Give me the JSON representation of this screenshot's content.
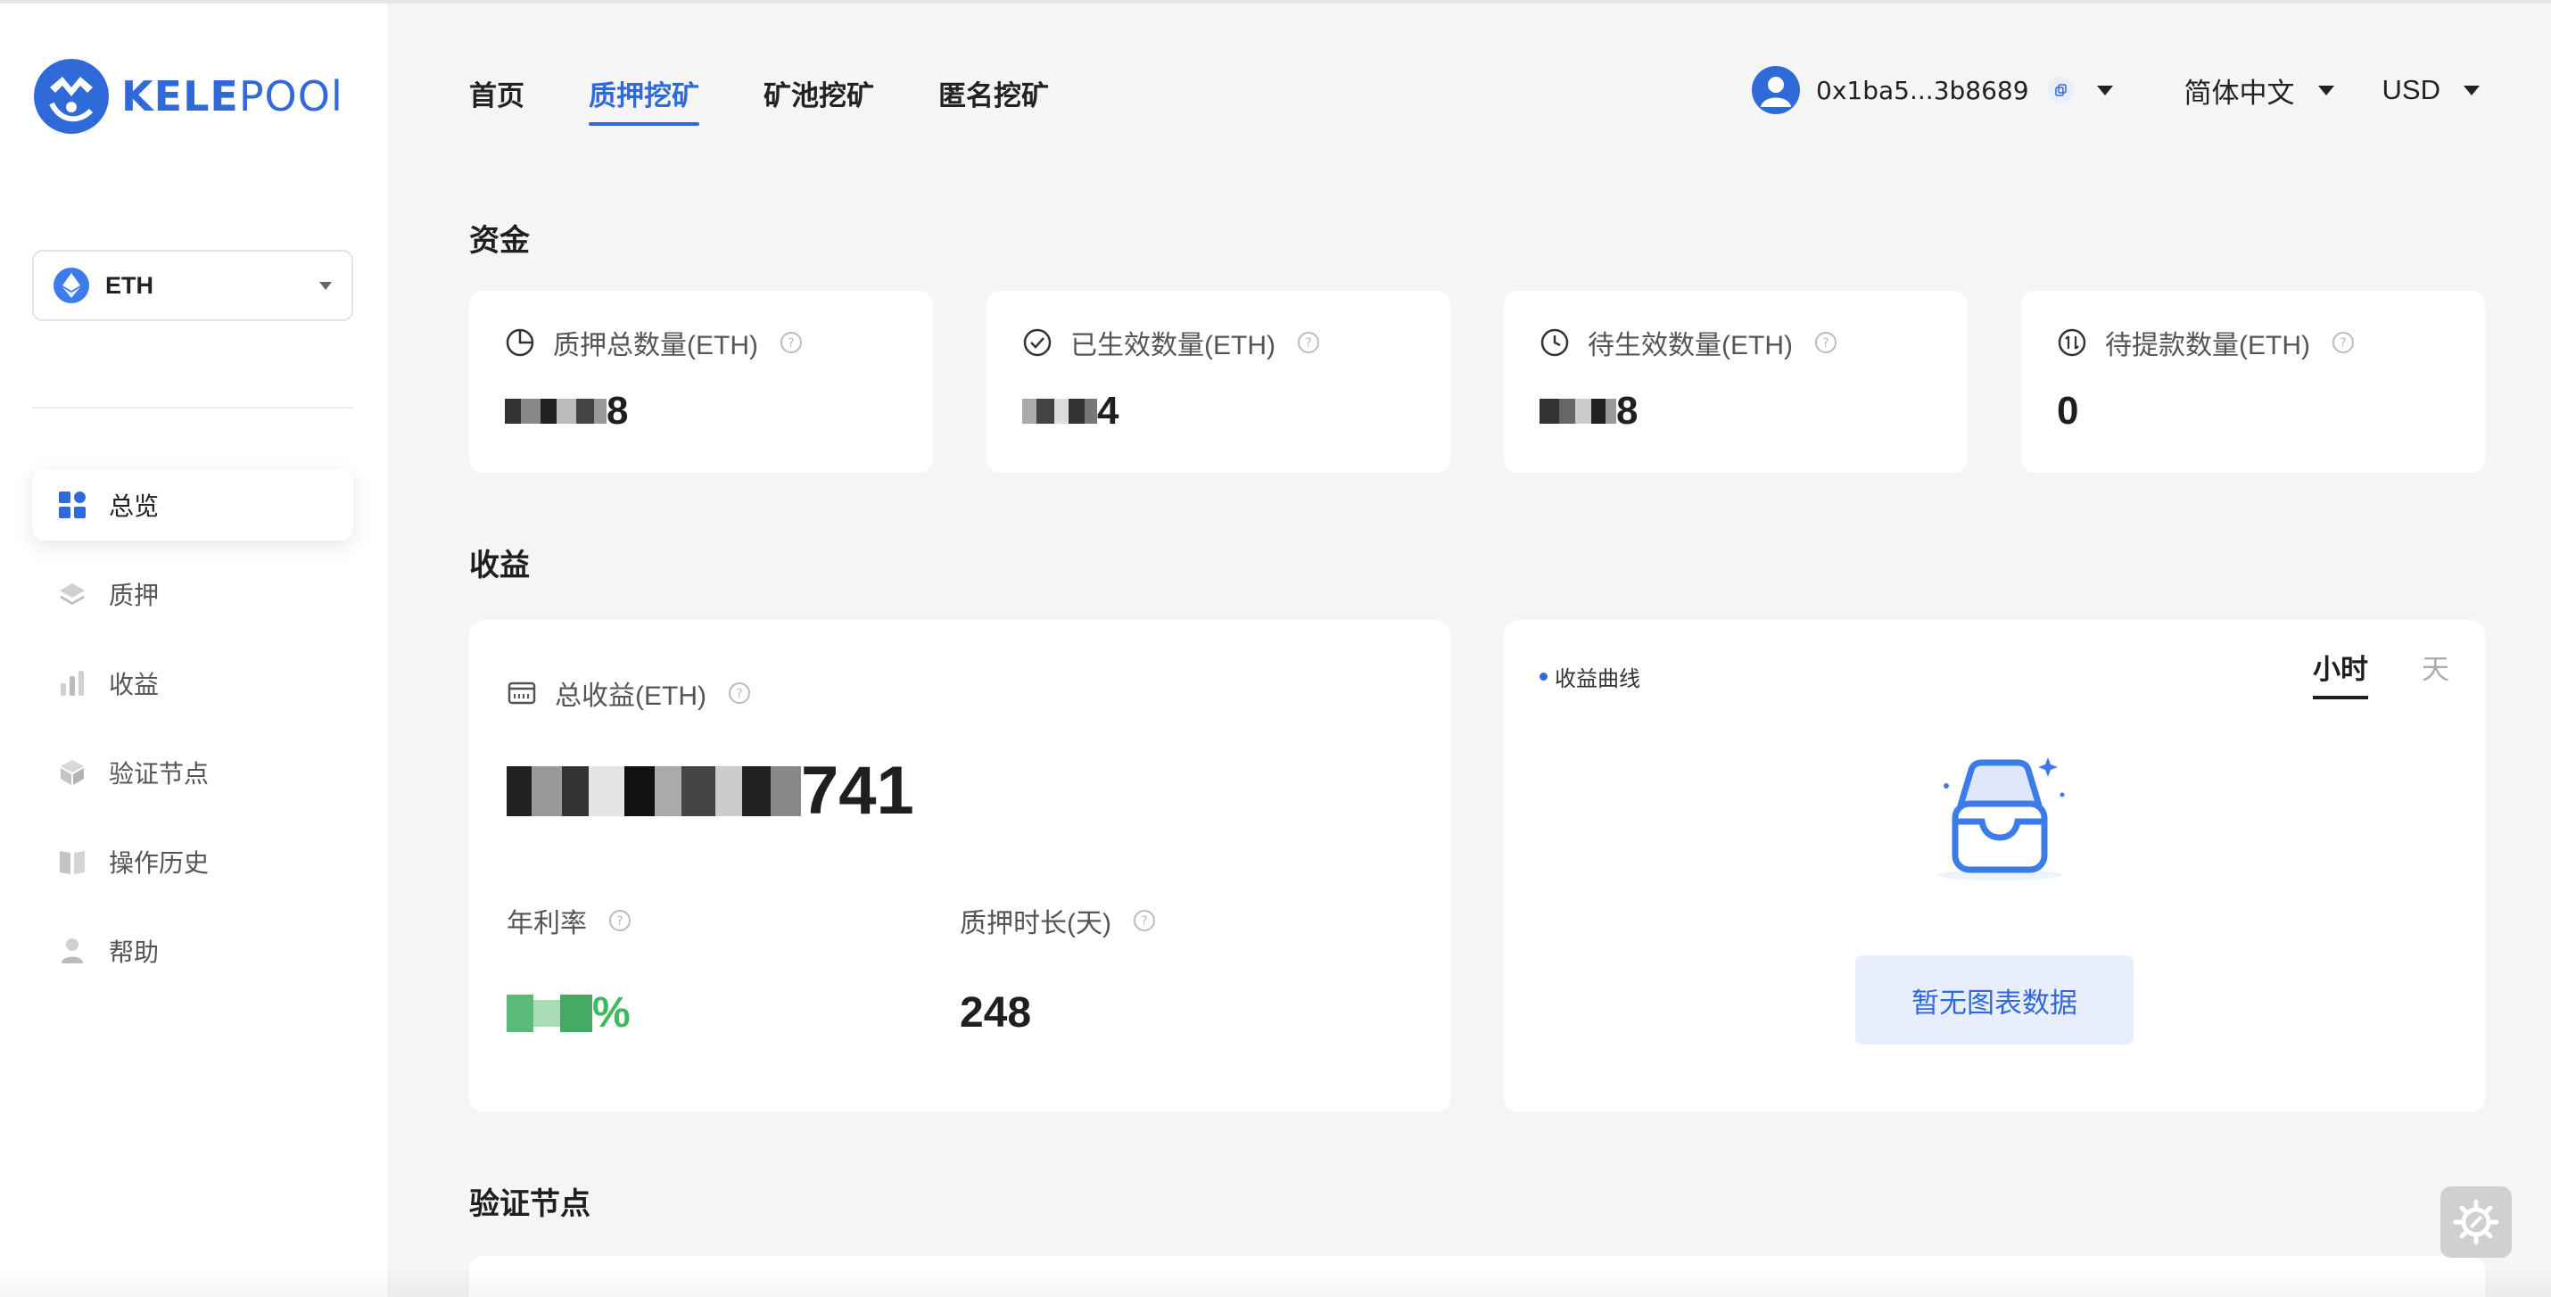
{
  "brand": {
    "name_bold": "KELE",
    "name_light": "POOl"
  },
  "asset": {
    "label": "ETH"
  },
  "sidebar": {
    "items": [
      {
        "label": "总览",
        "icon": "dashboard-icon",
        "active": true
      },
      {
        "label": "质押",
        "icon": "layers-icon",
        "active": false
      },
      {
        "label": "收益",
        "icon": "bar-chart-icon",
        "active": false
      },
      {
        "label": "验证节点",
        "icon": "cube-icon",
        "active": false
      },
      {
        "label": "操作历史",
        "icon": "book-icon",
        "active": false
      },
      {
        "label": "帮助",
        "icon": "user-help-icon",
        "active": false
      }
    ]
  },
  "topnav": {
    "items": [
      {
        "label": "首页",
        "active": false
      },
      {
        "label": "质押挖矿",
        "active": true
      },
      {
        "label": "矿池挖矿",
        "active": false
      },
      {
        "label": "匿名挖矿",
        "active": false
      }
    ]
  },
  "header": {
    "wallet": "0x1ba5...3b8689",
    "language": "简体中文",
    "currency": "USD"
  },
  "sections": {
    "funds": "资金",
    "earnings": "收益",
    "validators": "验证节点"
  },
  "stats": [
    {
      "label": "质押总数量(ETH)",
      "icon": "pie-icon",
      "value_visible": "8"
    },
    {
      "label": "已生效数量(ETH)",
      "icon": "check-circle-icon",
      "value_visible": "4"
    },
    {
      "label": "待生效数量(ETH)",
      "icon": "clock-icon",
      "value_visible": "8"
    },
    {
      "label": "待提款数量(ETH)",
      "icon": "withdraw-icon",
      "value_visible": "0"
    }
  ],
  "earnings": {
    "total_label": "总收益(ETH)",
    "total_value_visible": "741",
    "apr_label": "年利率",
    "apr_suffix": "%",
    "duration_label": "质押时长(天)",
    "duration_value": "248"
  },
  "chart": {
    "legend": "收益曲线",
    "tab_hour": "小时",
    "tab_day": "天",
    "empty_text": "暂无图表数据"
  },
  "colors": {
    "accent": "#2f6ad8",
    "positive": "#3dba5f",
    "background": "#f5f5f5"
  }
}
